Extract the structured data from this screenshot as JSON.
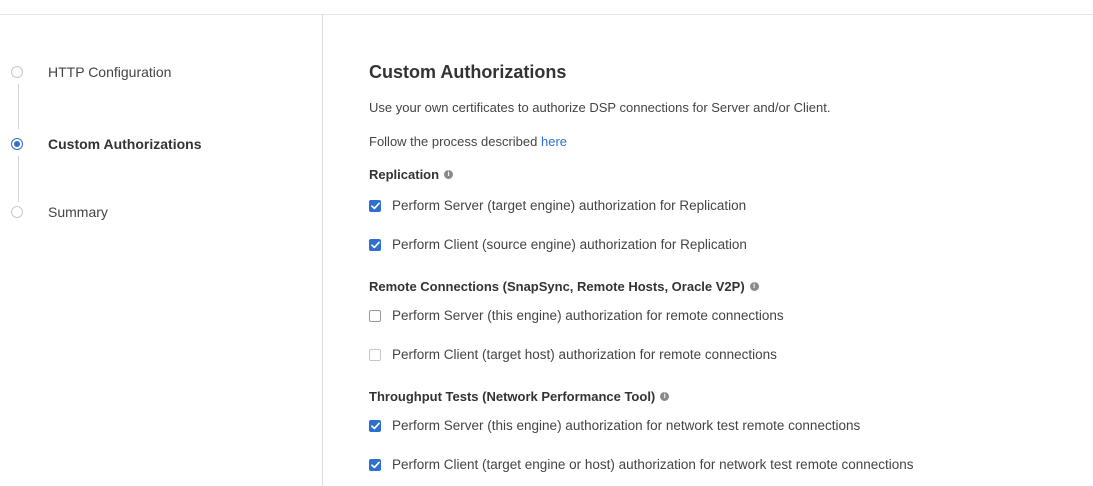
{
  "wizard": {
    "steps": [
      {
        "label": "HTTP Configuration",
        "state": "inactive"
      },
      {
        "label": "Custom Authorizations",
        "state": "active"
      },
      {
        "label": "Summary",
        "state": "inactive"
      }
    ],
    "accent_color": "#2f6fd0"
  },
  "main": {
    "title": "Custom Authorizations",
    "description": "Use your own certificates to authorize DSP connections for Server and/or Client.",
    "follow_prefix": "Follow the process described ",
    "follow_link": "here",
    "sections": [
      {
        "title": "Replication",
        "info_icon": "info-icon",
        "options": [
          {
            "label": "Perform Server (target engine) authorization for Replication",
            "checked": true,
            "disabled": false
          },
          {
            "label": "Perform Client (source engine) authorization for Replication",
            "checked": true,
            "disabled": false
          }
        ]
      },
      {
        "title": "Remote Connections (SnapSync, Remote Hosts, Oracle V2P)",
        "info_icon": "info-icon",
        "options": [
          {
            "label": "Perform Server (this engine) authorization for remote connections",
            "checked": false,
            "disabled": false
          },
          {
            "label": "Perform Client (target host) authorization for remote connections",
            "checked": false,
            "disabled": true
          }
        ]
      },
      {
        "title": "Throughput Tests (Network Performance Tool)",
        "info_icon": "info-icon",
        "options": [
          {
            "label": "Perform Server (this engine) authorization for network test remote connections",
            "checked": true,
            "disabled": false
          },
          {
            "label": "Perform Client (target engine or host) authorization for network test remote connections",
            "checked": true,
            "disabled": false
          }
        ]
      }
    ]
  }
}
